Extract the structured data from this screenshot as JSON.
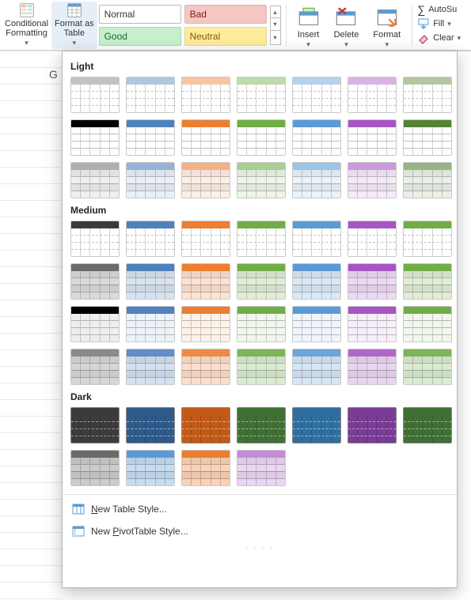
{
  "ribbon": {
    "cond_fmt_label": "Conditional\nFormatting",
    "fmt_table_label": "Format as\nTable",
    "cell_styles": {
      "normal": "Normal",
      "bad": "Bad",
      "good": "Good",
      "neutral": "Neutral"
    },
    "insert_label": "Insert",
    "delete_label": "Delete",
    "format_label": "Format",
    "autosum_label": "AutoSu",
    "fill_label": "Fill",
    "clear_label": "Clear"
  },
  "sheet": {
    "visible_cell_ref": "G"
  },
  "gallery": {
    "section_light": "Light",
    "section_medium": "Medium",
    "section_dark": "Dark",
    "new_table_style": "New Table Style...",
    "new_pivot_style": "New PivotTable Style...",
    "new_table_underline": "N",
    "new_pivot_underline": "P",
    "light": {
      "rows": 3,
      "colors": [
        "#7a7a7a",
        "#4f81bd",
        "#ed7d31",
        "#70ad47",
        "#5b9bd5",
        "#a855c4",
        "#548235"
      ]
    },
    "medium": {
      "rows": 4,
      "colors": [
        "#595959",
        "#4f81bd",
        "#ed7d31",
        "#70ad47",
        "#5b9bd5",
        "#a855c4",
        "#70ad47"
      ]
    },
    "dark": {
      "row1_colors": [
        "#3b3b3b",
        "#2e5b8a",
        "#c25a17",
        "#3f6f34",
        "#2e6fa0",
        "#7a3c94",
        "#3f6f34"
      ],
      "row2_count": 4,
      "row2_colors": [
        "#6b6b6b",
        "#5b9bd5",
        "#ed7d31",
        "#c48bd6"
      ]
    }
  }
}
